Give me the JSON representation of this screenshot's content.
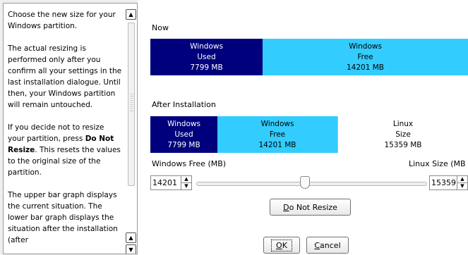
{
  "help": {
    "p1": "Choose the new size for your Windows partition.",
    "p2": "The actual resizing is performed only after you confirm all your settings in the last installation dialogue. Until then, your Windows partition will remain untouched.",
    "p3_pre": "If you decide not to resize your partition, press ",
    "p3_bold": "Do Not Resize",
    "p3_post": ". This resets the values to the original size of the partition.",
    "p4": "The upper bar graph displays the current situation. The lower bar graph displays the situation after the installation (after"
  },
  "now": {
    "label": "Now",
    "used": {
      "name": "Windows",
      "kind": "Used",
      "size": "7799 MB"
    },
    "free": {
      "name": "Windows",
      "kind": "Free",
      "size": "14201 MB"
    }
  },
  "after": {
    "label": "After Installation",
    "used": {
      "name": "Windows",
      "kind": "Used",
      "size": "7799 MB"
    },
    "free": {
      "name": "Windows",
      "kind": "Free",
      "size": "14201 MB"
    },
    "linux": {
      "name": "Linux",
      "kind": "Size",
      "size": "15359 MB"
    }
  },
  "controls": {
    "windows_free_label": "Windows Free (MB)",
    "linux_size_label": "Linux Size (MB",
    "windows_free_value": "14201",
    "linux_size_value": "15359",
    "do_not_resize_mnemonic": "D",
    "do_not_resize_rest": "o Not Resize",
    "ok_mnemonic": "O",
    "ok_rest": "K",
    "cancel_mnemonic": "C",
    "cancel_rest": "ancel"
  },
  "colors": {
    "used": "#00007c",
    "free": "#33ccff",
    "linux": "#ffffff"
  }
}
